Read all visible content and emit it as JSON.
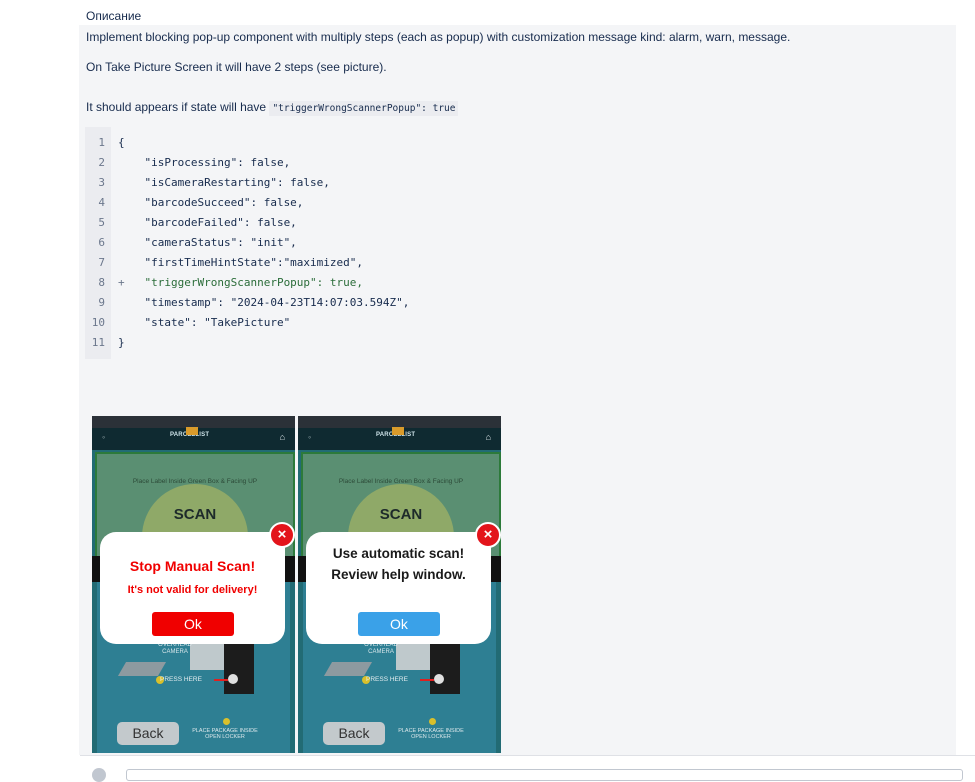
{
  "heading": "Описание",
  "paragraphs": {
    "p1": "Implement blocking pop-up component with multiply steps (each as popup) with customization message kind: alarm, warn, message.",
    "p2": "On Take Picture Screen it will have 2 steps (see picture).",
    "p3_prefix": "It should appears if state will have",
    "p3_code": "\"triggerWrongScannerPopup\": true"
  },
  "code": {
    "lines": [
      {
        "n": "1",
        "mark": "",
        "text": "{"
      },
      {
        "n": "2",
        "mark": "",
        "text": "    \"isProcessing\": false,"
      },
      {
        "n": "3",
        "mark": "",
        "text": "    \"isCameraRestarting\": false,"
      },
      {
        "n": "4",
        "mark": "",
        "text": "    \"barcodeSucceed\": false,"
      },
      {
        "n": "5",
        "mark": "",
        "text": "    \"barcodeFailed\": false,"
      },
      {
        "n": "6",
        "mark": "",
        "text": "    \"cameraStatus\": \"init\","
      },
      {
        "n": "7",
        "mark": "",
        "text": "    \"firstTimeHintState\":\"maximized\","
      },
      {
        "n": "8",
        "mark": "+",
        "text": "    \"triggerWrongScannerPopup\": true,"
      },
      {
        "n": "9",
        "mark": "",
        "text": "    \"timestamp\": \"2024-04-23T14:07:03.594Z\","
      },
      {
        "n": "10",
        "mark": "",
        "text": "    \"state\": \"TakePicture\""
      },
      {
        "n": "11",
        "mark": "",
        "text": "}"
      }
    ]
  },
  "screens": {
    "common": {
      "logo": "PARCELLIST",
      "place_label": "Place Label Inside Green Box & Facing UP",
      "scan_text": "SCAN",
      "overhead_camera": "OVERHEAD CAMERA",
      "press_here": "PRESS HERE",
      "place_package": "PLACE PACKAGE INSIDE OPEN LOCKER",
      "back_label": "Back",
      "close_glyph": "×"
    },
    "alarm": {
      "title": "Stop Manual Scan!",
      "subtitle": "It's not valid for delivery!",
      "ok_label": "Ok",
      "ok_color": "#f00000",
      "title_color": "#f00000"
    },
    "message": {
      "title_line1": "Use automatic scan!",
      "title_line2": "Review help window.",
      "ok_label": "Ok",
      "ok_color": "#3aa1e8",
      "title_color": "#1a1a1a"
    }
  },
  "colors": {
    "panel_bg": "#f4f5f7",
    "code_added": "#2b6d3a",
    "close_red": "#e3141b"
  }
}
